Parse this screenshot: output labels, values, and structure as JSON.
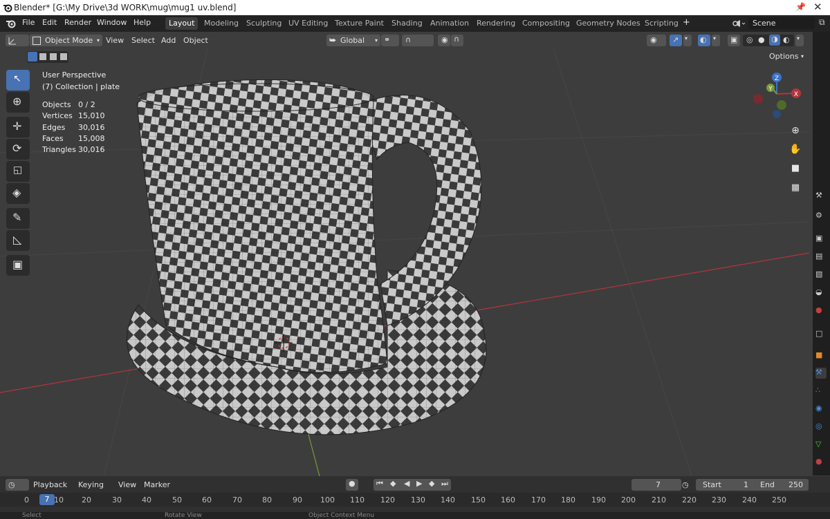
{
  "titlebar": {
    "title": "Blender* [G:\\My Drive\\3d WORK\\mug\\mug1 uv.blend]"
  },
  "menu": [
    "File",
    "Edit",
    "Render",
    "Window",
    "Help"
  ],
  "workspaces": [
    "Layout",
    "Modeling",
    "Sculpting",
    "UV Editing",
    "Texture Paint",
    "Shading",
    "Animation",
    "Rendering",
    "Compositing",
    "Geometry Nodes",
    "Scripting"
  ],
  "active_workspace": "Layout",
  "add_workspace": "+",
  "scene": {
    "name": "Scene"
  },
  "header": {
    "mode": "Object Mode",
    "menus": [
      "View",
      "Select",
      "Add",
      "Object"
    ],
    "transform_orientation": "Global",
    "options": "Options"
  },
  "viewport": {
    "perspective": "User Perspective",
    "collection": "(7) Collection | plate",
    "stats": [
      {
        "label": "Objects",
        "value": "0 / 2"
      },
      {
        "label": "Vertices",
        "value": "15,010"
      },
      {
        "label": "Edges",
        "value": "30,016"
      },
      {
        "label": "Faces",
        "value": "15,008"
      },
      {
        "label": "Triangles",
        "value": "30,016"
      }
    ],
    "gizmo": {
      "z": "Z",
      "y": "Y",
      "x": "X"
    }
  },
  "timeline": {
    "menus": [
      "Playback",
      "Keying",
      "View",
      "Marker"
    ],
    "current_frame": "7",
    "start_label": "Start",
    "start_value": "1",
    "end_label": "End",
    "end_value": "250",
    "ruler": [
      "0",
      "10",
      "20",
      "30",
      "40",
      "50",
      "60",
      "70",
      "80",
      "90",
      "100",
      "110",
      "120",
      "130",
      "140",
      "150",
      "160",
      "170",
      "180",
      "190",
      "200",
      "210",
      "220",
      "230",
      "240",
      "250"
    ],
    "playhead": "7"
  },
  "status": [
    "Select",
    "Rotate View",
    "Object Context Menu"
  ],
  "colors": {
    "accent": "#4772b3",
    "axis_x": "#b5343c",
    "axis_y": "#7a9a3a",
    "axis_z": "#3b72c8"
  }
}
